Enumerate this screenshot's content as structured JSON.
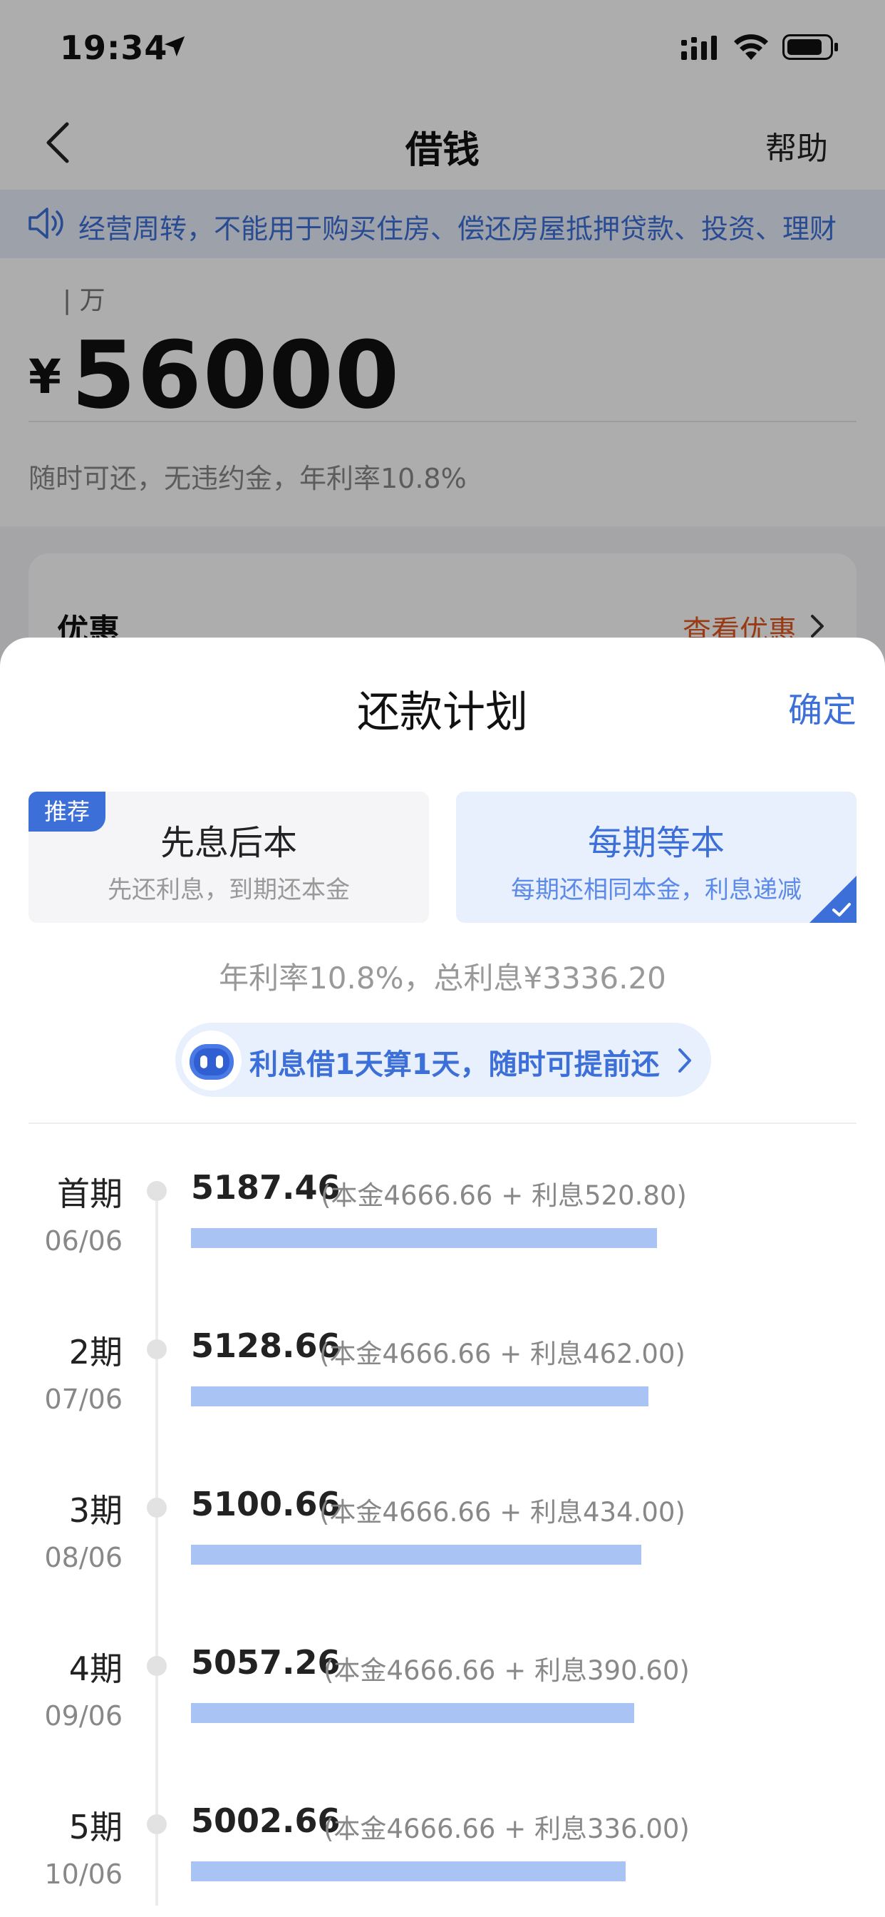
{
  "status_bar": {
    "time": "19:34"
  },
  "nav": {
    "title": "借钱",
    "help": "帮助"
  },
  "notice": {
    "text": "经营周转，不能用于购买住房、偿还房屋抵押贷款、投资、理财"
  },
  "amount": {
    "unit": "万",
    "currency": "¥",
    "value": "56000",
    "description": "随时可还，无违约金，年利率10.8%"
  },
  "offer": {
    "title": "优惠",
    "link": "查看优惠"
  },
  "sheet": {
    "title": "还款计划",
    "confirm": "确定",
    "plans": [
      {
        "badge": "推荐",
        "name": "先息后本",
        "desc": "先还利息，到期还本金",
        "selected": false
      },
      {
        "name": "每期等本",
        "desc": "每期还相同本金，利息递减",
        "selected": true
      }
    ],
    "rate_summary": "年利率10.8%，总利息¥3336.20",
    "interest_pill": "利息借1天算1天，随时可提前还",
    "schedule": [
      {
        "period": "首期",
        "date": "06/06",
        "amount": "5187.46",
        "breakdown": "(本金4666.66 + 利息520.80)"
      },
      {
        "period": "2期",
        "date": "07/06",
        "amount": "5128.66",
        "breakdown": "(本金4666.66 + 利息462.00)"
      },
      {
        "period": "3期",
        "date": "08/06",
        "amount": "5100.66",
        "breakdown": "(本金4666.66 + 利息434.00)"
      },
      {
        "period": "4期",
        "date": "09/06",
        "amount": "5057.26",
        "breakdown": "(本金4666.66 + 利息390.60)"
      },
      {
        "period": "5期",
        "date": "10/06",
        "amount": "5002.66",
        "breakdown": "(本金4666.66 + 利息336.00)"
      }
    ]
  },
  "colors": {
    "accent": "#3d6fd8",
    "bar": "#a9c4f4",
    "offer_link": "#e0581f"
  }
}
